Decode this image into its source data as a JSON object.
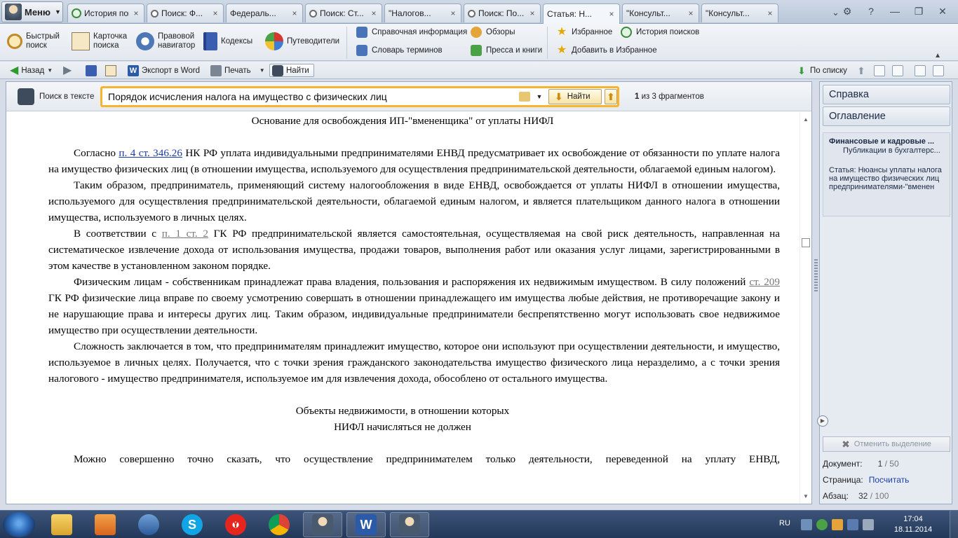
{
  "menu": {
    "label": "Меню"
  },
  "tabs": [
    {
      "label": "История поисков",
      "icon": "history-icon"
    },
    {
      "label": "Поиск: Ф...",
      "icon": "search-icon"
    },
    {
      "label": "Федераль...",
      "icon": "document-icon"
    },
    {
      "label": "Поиск: Ст...",
      "icon": "search-icon"
    },
    {
      "label": "\"Налогов...",
      "icon": "document-icon"
    },
    {
      "label": "Поиск: По...",
      "icon": "search-icon"
    },
    {
      "label": "Статья: Н...",
      "icon": "document-icon",
      "active": true
    },
    {
      "label": "\"Консульт...",
      "icon": "document-icon"
    },
    {
      "label": "\"Консульт...",
      "icon": "document-icon"
    }
  ],
  "ribbon": {
    "quick_search": "Быстрый\nпоиск",
    "card_search": "Карточка\nпоиска",
    "legal_navigator": "Правовой\nнавигатор",
    "codes": "Кодексы",
    "guides": "Путеводители",
    "reference_info": "Справочная информация",
    "glossary": "Словарь терминов",
    "reviews": "Обзоры",
    "press_books": "Пресса и книги",
    "favorites": "Избранное",
    "add_favorites": "Добавить в Избранное",
    "search_history": "История поисков"
  },
  "navbar": {
    "back": "Назад",
    "export_word": "Экспорт в Word",
    "print": "Печать",
    "find": "Найти",
    "by_list": "По списку"
  },
  "search": {
    "label": "Поиск в тексте",
    "value": "Порядок исчисления  налога на имущество с физических лиц",
    "find_button": "Найти",
    "count_bold": "1",
    "count_rest": " из 3 фрагментов"
  },
  "document": {
    "heading1": "Основание для освобождения ИП-\"вмененщика\" от уплаты НИФЛ",
    "p1_pre": "Согласно ",
    "p1_link": "п. 4 ст. 346.26",
    "p1_post": " НК РФ уплата индивидуальными предпринимателями ЕНВД предусматривает их освобождение от обязанности по уплате налога на имущество физических лиц (в отношении имущества, используемого для осуществления предпринимательской деятельности, облагаемой единым налогом).",
    "p2": "Таким образом, предприниматель, применяющий систему налогообложения в виде ЕНВД, освобождается от уплаты НИФЛ в отношении имущества, используемого для осуществления предпринимательской деятельности, облагаемой единым налогом, и является плательщиком данного налога в отношении имущества, используемого в личных целях.",
    "p3_pre": "В соответствии с ",
    "p3_link": "п. 1 ст. 2",
    "p3_post": " ГК РФ предпринимательской является самостоятельная, осуществляемая на свой риск деятельность, направленная на систематическое извлечение дохода от использования имущества, продажи товаров, выполнения работ или оказания услуг лицами, зарегистрированными в этом качестве в установленном законом порядке.",
    "p4_pre": "Физическим лицам - собственникам принадлежат права владения, пользования и распоряжения их недвижимым имуществом. В силу положений ",
    "p4_link": "ст. 209",
    "p4_post": " ГК РФ физические лица вправе по своему усмотрению совершать в отношении принадлежащего им имущества любые действия, не противоречащие закону и не нарушающие права и интересы других лиц. Таким образом, индивидуальные предприниматели беспрепятственно могут использовать свое недвижимое имущество при осуществлении деятельности.",
    "p5": "Сложность заключается в том, что предпринимателям принадлежит имущество, которое они используют при осуществлении деятельности, и имущество, используемое в личных целях. Получается, что с точки зрения гражданского законодательства имущество физического лица неразделимо, а с точки зрения налогового - имущество предпринимателя, используемое им для извлечения дохода, обособлено от остального имущества.",
    "heading2_line1": "Объекты недвижимости, в отношении которых",
    "heading2_line2": "НИФЛ начисляться не должен",
    "p6": "Можно совершенно точно сказать, что осуществление предпринимателем только деятельности, переведенной на уплату ЕНВД,"
  },
  "right_panel": {
    "tab_help": "Справка",
    "tab_toc": "Оглавление",
    "card_title": "Финансовые и кадровые ...",
    "card_subtitle": "Публикации в бухгалтерс...",
    "card_text_prefix": "Статья:",
    "card_text": " Нюансы уплаты налога на имущество физических лиц предпринимателями-\"вменен",
    "unselect": "Отменить выделение",
    "doc_label": "Документ:",
    "doc_value": "1",
    "doc_total": " / 50",
    "page_label": "Страница:",
    "page_value": "Посчитать",
    "para_label": "Абзац:",
    "para_value": "32",
    "para_total": " / 100"
  },
  "taskbar": {
    "lang": "RU",
    "time": "17:04",
    "date": "18.11.2014"
  },
  "colors": {
    "search_highlight": "#f5b52f",
    "link": "#1a3ea8",
    "taskbar": "#22385a"
  }
}
